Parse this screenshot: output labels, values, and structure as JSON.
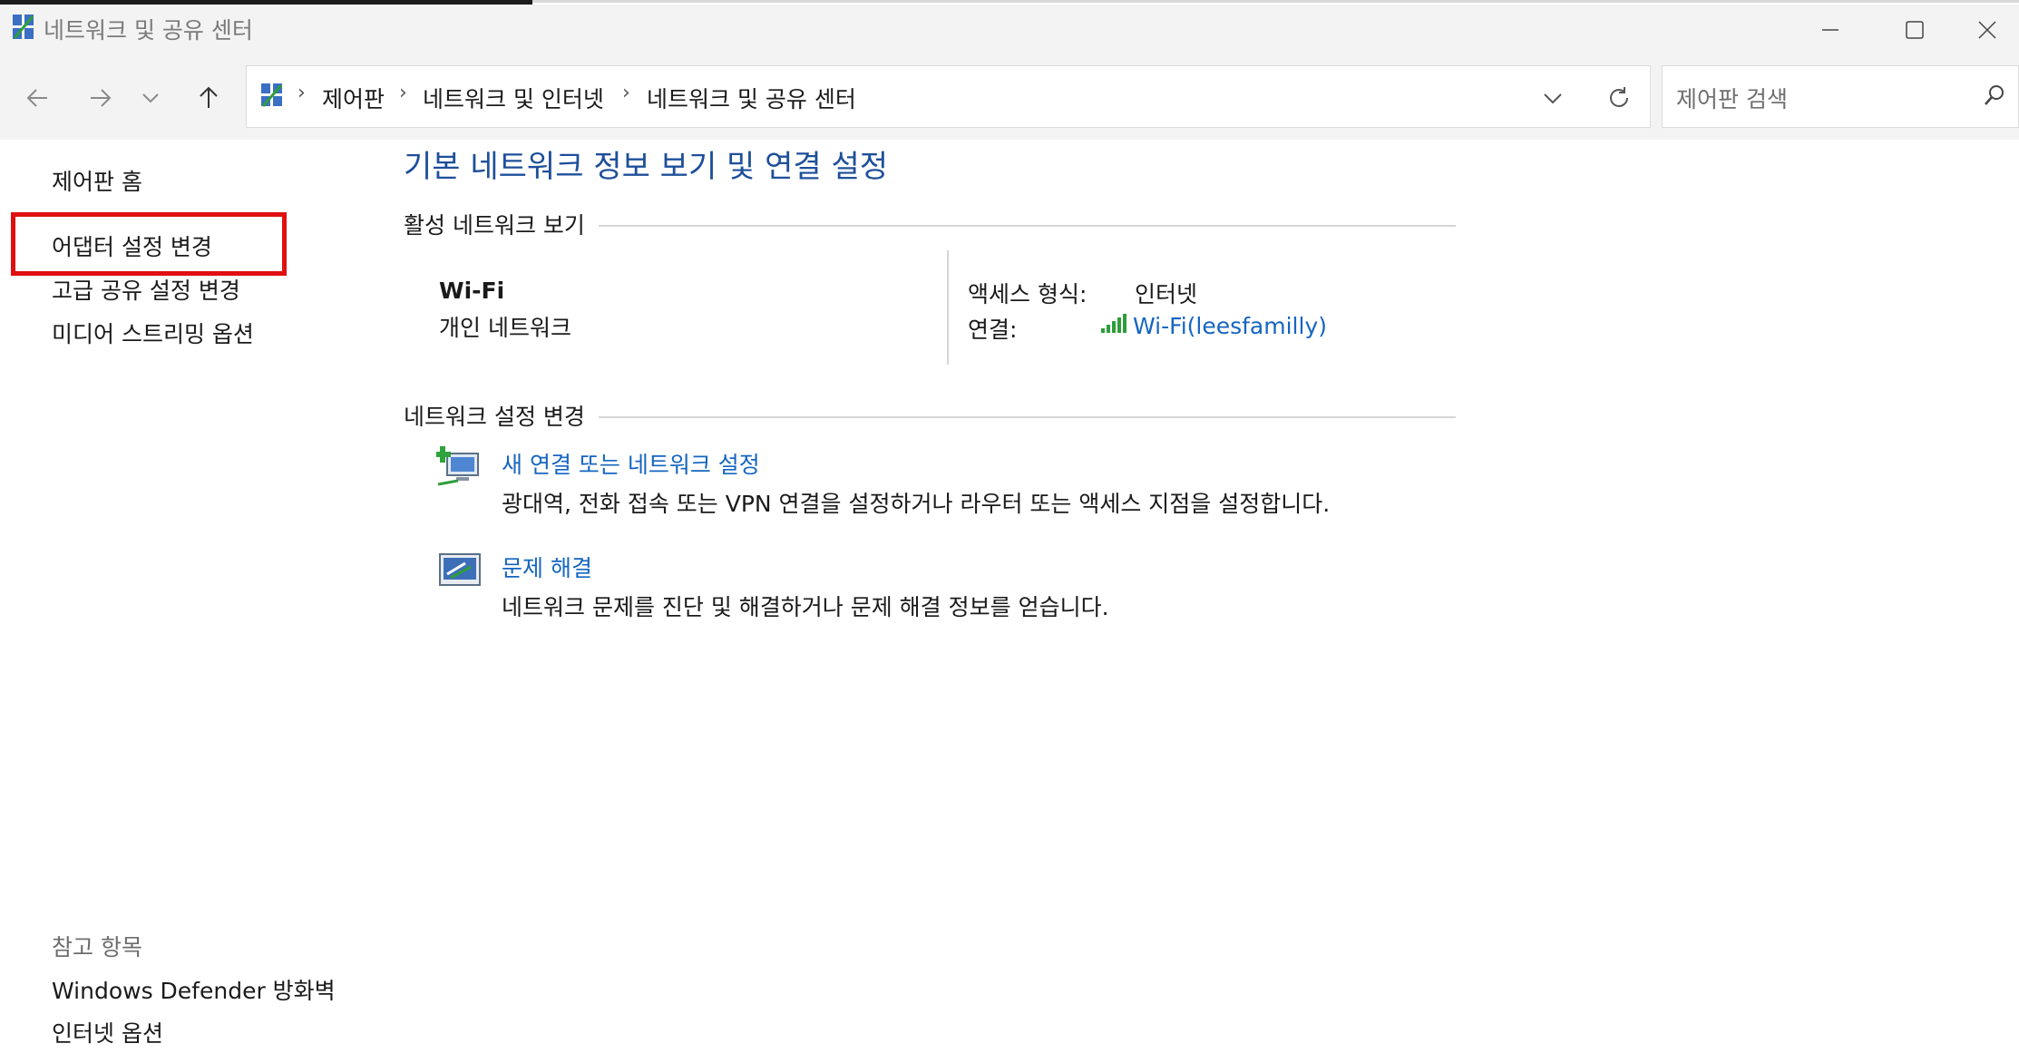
{
  "window": {
    "title": "네트워크 및 공유 센터"
  },
  "address_bar": {
    "breadcrumbs": [
      "제어판",
      "네트워크 및 인터넷",
      "네트워크 및 공유 센터"
    ]
  },
  "search": {
    "placeholder": "제어판 검색"
  },
  "sidebar": {
    "items": [
      {
        "label": "제어판 홈"
      },
      {
        "label": "어댑터 설정 변경"
      },
      {
        "label": "고급 공유 설정 변경"
      },
      {
        "label": "미디어 스트리밍 옵션"
      }
    ],
    "see_also_title": "참고 항목",
    "see_also": [
      {
        "label": "Windows Defender 방화벽"
      },
      {
        "label": "인터넷 옵션"
      }
    ]
  },
  "main": {
    "title": "기본 네트워크 정보 보기 및 연결 설정",
    "active_network_header": "활성 네트워크 보기",
    "network": {
      "name": "Wi-Fi",
      "type": "개인 네트워크",
      "access_label": "액세스 형식:",
      "access_value": "인터넷",
      "connection_label": "연결:",
      "connection_value": "Wi-Fi(leesfamilly)"
    },
    "change_settings_header": "네트워크 설정 변경",
    "tasks": [
      {
        "title": "새 연결 또는 네트워크 설정",
        "description": "광대역, 전화 접속 또는 VPN 연결을 설정하거나 라우터 또는 액세스 지점을 설정합니다."
      },
      {
        "title": "문제 해결",
        "description": "네트워크 문제를 진단 및 해결하거나 문제 해결 정보를 얻습니다."
      }
    ]
  },
  "colors": {
    "link": "#1565c0",
    "title": "#1e4f9a",
    "highlight": "#e01010",
    "signal": "#2e9e3a"
  }
}
